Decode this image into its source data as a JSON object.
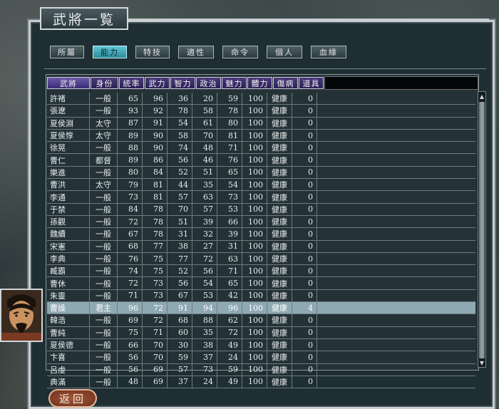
{
  "window": {
    "title": "武將一覧"
  },
  "tabs": [
    "所屬",
    "能力",
    "特技",
    "適性",
    "命令",
    "個人",
    "血緣"
  ],
  "active_tab": "能力",
  "columns": [
    "武將",
    "身份",
    "統率",
    "武力",
    "智力",
    "政治",
    "魅力",
    "體力",
    "傷病",
    "道具"
  ],
  "rows": [
    {
      "name": "許褚",
      "rank": "一般",
      "lead": "65",
      "war": "96",
      "int": "36",
      "pol": "20",
      "cha": "59",
      "hp": "100",
      "hurt": "健康",
      "item": "0"
    },
    {
      "name": "張遼",
      "rank": "一般",
      "lead": "93",
      "war": "92",
      "int": "78",
      "pol": "58",
      "cha": "78",
      "hp": "100",
      "hurt": "健康",
      "item": "0"
    },
    {
      "name": "夏侯淵",
      "rank": "太守",
      "lead": "87",
      "war": "91",
      "int": "54",
      "pol": "61",
      "cha": "80",
      "hp": "100",
      "hurt": "健康",
      "item": "0"
    },
    {
      "name": "夏侯惇",
      "rank": "太守",
      "lead": "89",
      "war": "90",
      "int": "58",
      "pol": "70",
      "cha": "81",
      "hp": "100",
      "hurt": "健康",
      "item": "0"
    },
    {
      "name": "徐晃",
      "rank": "一般",
      "lead": "88",
      "war": "90",
      "int": "74",
      "pol": "48",
      "cha": "71",
      "hp": "100",
      "hurt": "健康",
      "item": "0"
    },
    {
      "name": "曹仁",
      "rank": "都督",
      "lead": "89",
      "war": "86",
      "int": "56",
      "pol": "46",
      "cha": "76",
      "hp": "100",
      "hurt": "健康",
      "item": "0"
    },
    {
      "name": "樂進",
      "rank": "一般",
      "lead": "80",
      "war": "84",
      "int": "52",
      "pol": "51",
      "cha": "65",
      "hp": "100",
      "hurt": "健康",
      "item": "0"
    },
    {
      "name": "曹洪",
      "rank": "太守",
      "lead": "79",
      "war": "81",
      "int": "44",
      "pol": "35",
      "cha": "54",
      "hp": "100",
      "hurt": "健康",
      "item": "0"
    },
    {
      "name": "李通",
      "rank": "一般",
      "lead": "73",
      "war": "81",
      "int": "57",
      "pol": "63",
      "cha": "73",
      "hp": "100",
      "hurt": "健康",
      "item": "0"
    },
    {
      "name": "于禁",
      "rank": "一般",
      "lead": "84",
      "war": "78",
      "int": "70",
      "pol": "57",
      "cha": "53",
      "hp": "100",
      "hurt": "健康",
      "item": "0"
    },
    {
      "name": "孫觀",
      "rank": "一般",
      "lead": "72",
      "war": "78",
      "int": "51",
      "pol": "39",
      "cha": "66",
      "hp": "100",
      "hurt": "健康",
      "item": "0"
    },
    {
      "name": "魏續",
      "rank": "一般",
      "lead": "67",
      "war": "78",
      "int": "31",
      "pol": "32",
      "cha": "39",
      "hp": "100",
      "hurt": "健康",
      "item": "0"
    },
    {
      "name": "宋憲",
      "rank": "一般",
      "lead": "68",
      "war": "77",
      "int": "38",
      "pol": "27",
      "cha": "31",
      "hp": "100",
      "hurt": "健康",
      "item": "0"
    },
    {
      "name": "李典",
      "rank": "一般",
      "lead": "76",
      "war": "75",
      "int": "77",
      "pol": "72",
      "cha": "63",
      "hp": "100",
      "hurt": "健康",
      "item": "0"
    },
    {
      "name": "臧霸",
      "rank": "一般",
      "lead": "74",
      "war": "75",
      "int": "52",
      "pol": "56",
      "cha": "71",
      "hp": "100",
      "hurt": "健康",
      "item": "0"
    },
    {
      "name": "曹休",
      "rank": "一般",
      "lead": "72",
      "war": "73",
      "int": "56",
      "pol": "54",
      "cha": "65",
      "hp": "100",
      "hurt": "健康",
      "item": "0"
    },
    {
      "name": "朱靈",
      "rank": "一般",
      "lead": "71",
      "war": "73",
      "int": "67",
      "pol": "53",
      "cha": "42",
      "hp": "100",
      "hurt": "健康",
      "item": "0"
    },
    {
      "name": "曹操",
      "rank": "君主",
      "lead": "96",
      "war": "72",
      "int": "91",
      "pol": "94",
      "cha": "96",
      "hp": "100",
      "hurt": "健康",
      "item": "4"
    },
    {
      "name": "韓浩",
      "rank": "一般",
      "lead": "69",
      "war": "72",
      "int": "68",
      "pol": "88",
      "cha": "62",
      "hp": "100",
      "hurt": "健康",
      "item": "0"
    },
    {
      "name": "曹純",
      "rank": "一般",
      "lead": "75",
      "war": "71",
      "int": "60",
      "pol": "35",
      "cha": "72",
      "hp": "100",
      "hurt": "健康",
      "item": "0"
    },
    {
      "name": "夏侯德",
      "rank": "一般",
      "lead": "66",
      "war": "70",
      "int": "30",
      "pol": "38",
      "cha": "49",
      "hp": "100",
      "hurt": "健康",
      "item": "0"
    },
    {
      "name": "卞喜",
      "rank": "一般",
      "lead": "56",
      "war": "70",
      "int": "59",
      "pol": "37",
      "cha": "24",
      "hp": "100",
      "hurt": "健康",
      "item": "0"
    },
    {
      "name": "呂虔",
      "rank": "一般",
      "lead": "56",
      "war": "69",
      "int": "57",
      "pol": "73",
      "cha": "59",
      "hp": "100",
      "hurt": "健康",
      "item": "0"
    },
    {
      "name": "典滿",
      "rank": "一般",
      "lead": "48",
      "war": "69",
      "int": "37",
      "pol": "24",
      "cha": "49",
      "hp": "100",
      "hurt": "健康",
      "item": "0"
    }
  ],
  "selected_row": 17,
  "back_button": "返回",
  "icons": {
    "portrait": "officer-portrait",
    "scroll_up": "▲",
    "scroll_down": "▼"
  },
  "colors": {
    "selected_row": "#8fa9b3",
    "active_tab": "#5fc8d8",
    "header": "#2b2156"
  }
}
